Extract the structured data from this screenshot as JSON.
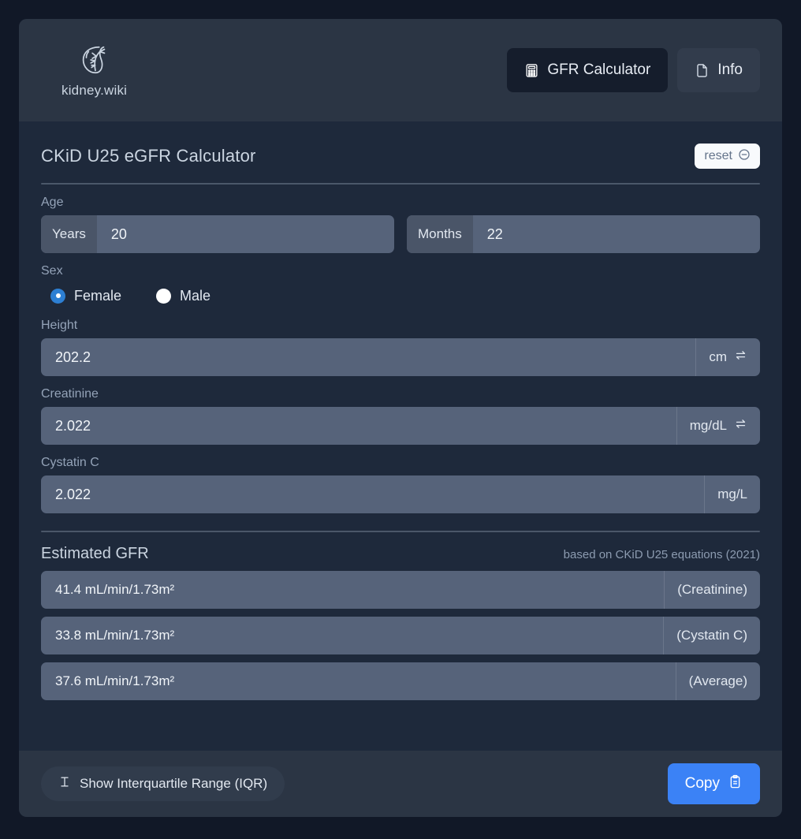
{
  "brand": {
    "logo_icon": "kidney-icon",
    "name": "kidney.wiki"
  },
  "header": {
    "tabs": [
      {
        "label": "GFR Calculator",
        "icon": "calculator-icon",
        "active": true
      },
      {
        "label": "Info",
        "icon": "document-icon",
        "active": false
      }
    ]
  },
  "panel": {
    "title": "CKiD U25 eGFR Calculator",
    "reset_label": "reset",
    "reset_icon": "circle-minus-icon"
  },
  "form": {
    "age": {
      "label": "Age",
      "years": {
        "prefix": "Years",
        "value": "20",
        "placeholder": "Years"
      },
      "months": {
        "prefix": "Months",
        "value": "22",
        "placeholder": "Months"
      }
    },
    "sex": {
      "label": "Sex",
      "options": [
        {
          "label": "Female",
          "selected": true
        },
        {
          "label": "Male",
          "selected": false
        }
      ]
    },
    "height": {
      "label": "Height",
      "value": "202.2",
      "placeholder": "Height",
      "unit": "cm",
      "unit_swap_icon": "swap-arrows-icon"
    },
    "creatinine": {
      "label": "Creatinine",
      "value": "2.022",
      "placeholder": "Creatinine",
      "unit": "mg/dL",
      "unit_swap_icon": "swap-arrows-icon"
    },
    "cystatin_c": {
      "label": "Cystatin C",
      "value": "2.022",
      "placeholder": "Cystatin C",
      "unit": "mg/L"
    }
  },
  "results": {
    "title": "Estimated GFR",
    "subtitle": "based on CKiD U25 equations (2021)",
    "rows": [
      {
        "value": "41.4 mL/min/1.73m²",
        "source": "(Creatinine)"
      },
      {
        "value": "33.8 mL/min/1.73m²",
        "source": "(Cystatin C)"
      },
      {
        "value": "37.6 mL/min/1.73m²",
        "source": "(Average)"
      }
    ]
  },
  "footer": {
    "iqr_label": "Show Interquartile Range (IQR)",
    "iqr_icon": "error-bar-icon",
    "copy_label": "Copy",
    "copy_icon": "clipboard-icon"
  },
  "colors": {
    "page_background": "#111827",
    "card_background": "#1e293b",
    "bar_background": "#2b3544",
    "input_background": "#56637a",
    "input_prefix_background": "#4a5568",
    "accent_blue": "#3b82f6",
    "radio_selected": "#2d7fd3",
    "reset_button": "#f8fafc"
  }
}
